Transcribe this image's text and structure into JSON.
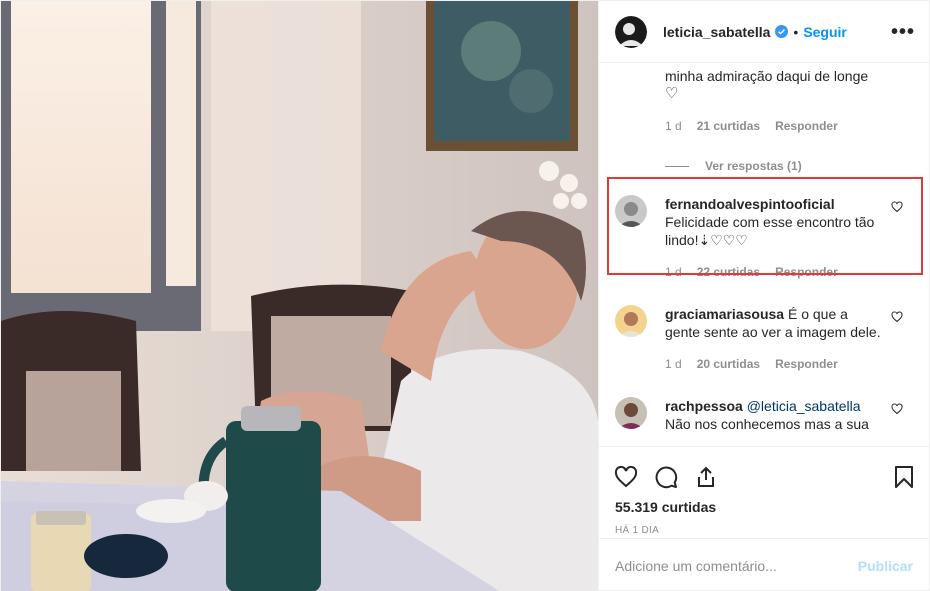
{
  "post": {
    "author": "leticia_sabatella",
    "dot": "•",
    "follow_label": "Seguir",
    "more_icon": "more-horizontal-icon"
  },
  "comments": [
    {
      "id": "c0",
      "text_tail": "minha admiração daqui de longe",
      "emoji": "♡",
      "time": "1 d",
      "likes": "21 curtidas",
      "reply_label": "Responder",
      "view_replies": "Ver respostas (1)"
    },
    {
      "id": "c1",
      "user": "fernandoalvespintooficial",
      "text": "Felicidade com esse encontro tão lindo!",
      "emoji": "⇣♡♡♡",
      "time": "1 d",
      "likes": "22 curtidas",
      "reply_label": "Responder"
    },
    {
      "id": "c2",
      "user": "graciamariasousa",
      "text": "É o que a gente sente ao ver a imagem dele.",
      "time": "1 d",
      "likes": "20 curtidas",
      "reply_label": "Responder"
    },
    {
      "id": "c3",
      "user": "rachpessoa",
      "mention": "@leticia_sabatella",
      "text": "Não nos conhecemos mas a sua"
    }
  ],
  "actions": {
    "likes": "55.319 curtidas",
    "date": "HÁ 1 DIA"
  },
  "add_comment": {
    "placeholder": "Adicione um comentário...",
    "publish_label": "Publicar"
  },
  "colors": {
    "link": "#0095f6",
    "highlight": "#e53935",
    "muted": "#8e8e8e",
    "publish_disabled": "#b2dffc"
  }
}
